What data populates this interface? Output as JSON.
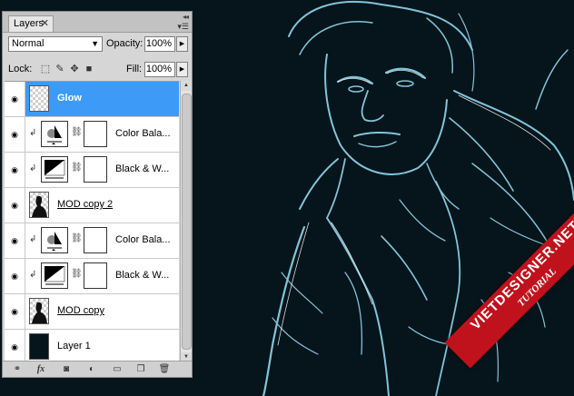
{
  "panel": {
    "tab_label": "Layers",
    "blend_mode": "Normal",
    "opacity_label": "Opacity:",
    "opacity_value": "100%",
    "lock_label": "Lock:",
    "fill_label": "Fill:",
    "fill_value": "100%"
  },
  "layers": [
    {
      "name": "Glow",
      "type": "raster-transparent",
      "visible": true,
      "selected": true
    },
    {
      "name": "Color Bala...",
      "type": "adjustment-color-balance",
      "visible": true,
      "clipped": true
    },
    {
      "name": "Black & W...",
      "type": "adjustment-black-white",
      "visible": true,
      "clipped": true
    },
    {
      "name": "MOD copy 2",
      "type": "raster-figure",
      "visible": true
    },
    {
      "name": "Color Bala...",
      "type": "adjustment-color-balance",
      "visible": true,
      "clipped": true
    },
    {
      "name": "Black & W...",
      "type": "adjustment-black-white",
      "visible": true,
      "clipped": true
    },
    {
      "name": "MOD copy",
      "type": "raster-figure",
      "visible": true
    },
    {
      "name": "Layer 1",
      "type": "raster-dark",
      "visible": true
    }
  ],
  "watermark": {
    "site": "VIETDESIGNER.NET",
    "label": "TUTORIAL"
  },
  "colors": {
    "selection": "#3d9bf7",
    "canvas_bg": "#06141b",
    "glow": "#8fd8ee",
    "watermark": "#c0121c"
  }
}
